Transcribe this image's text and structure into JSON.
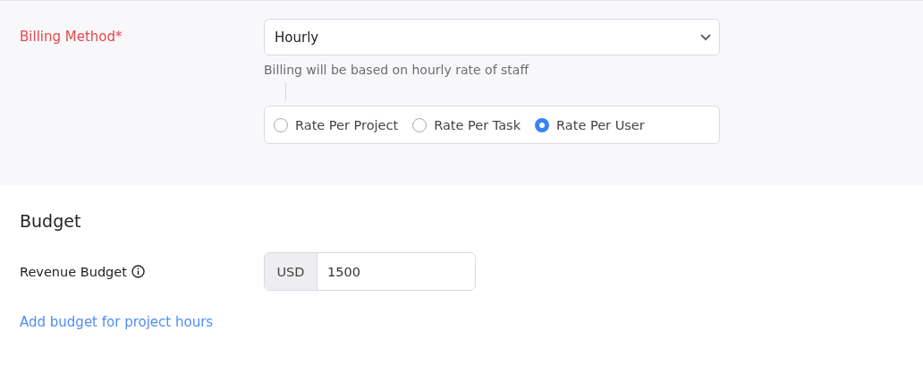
{
  "billing": {
    "label": "Billing Method*",
    "required": true,
    "select": {
      "value": "Hourly"
    },
    "hint": "Billing will be based on hourly rate of staff",
    "options": [
      {
        "label": "Rate Per Project",
        "selected": false
      },
      {
        "label": "Rate Per Task",
        "selected": false
      },
      {
        "label": "Rate Per User",
        "selected": true
      }
    ]
  },
  "budget": {
    "heading": "Budget",
    "revenue": {
      "label": "Revenue Budget",
      "currency": "USD",
      "value": "1500"
    },
    "link": "Add budget for project hours"
  }
}
